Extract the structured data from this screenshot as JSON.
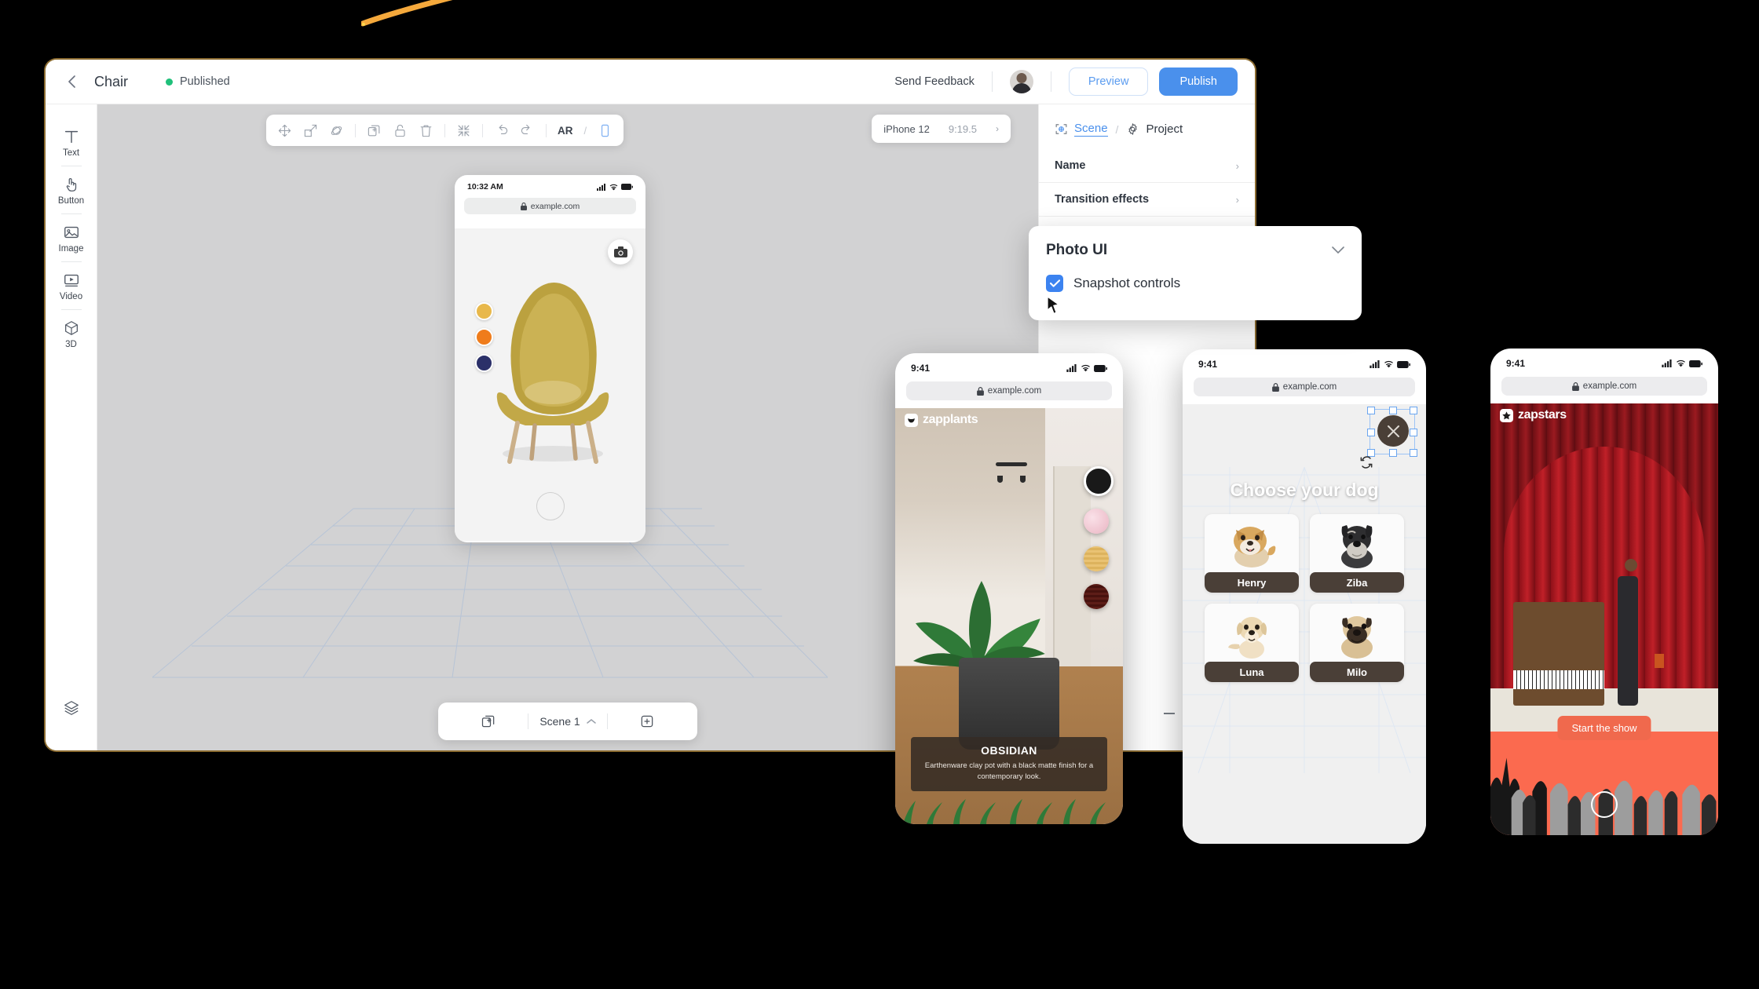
{
  "app": {
    "title": "Chair",
    "status": "Published",
    "status_color": "#1fc07a",
    "back_icon": "chevron-left-icon",
    "header": {
      "feedback": "Send Feedback",
      "preview": "Preview",
      "publish": "Publish",
      "accent": "#4a90ec"
    }
  },
  "sidebar": {
    "items": [
      {
        "label": "Text",
        "icon": "text-icon"
      },
      {
        "label": "Button",
        "icon": "button-tap-icon"
      },
      {
        "label": "Image",
        "icon": "image-icon"
      },
      {
        "label": "Video",
        "icon": "video-icon"
      },
      {
        "label": "3D",
        "icon": "cube-3d-icon"
      }
    ],
    "bottom_icon": "layers-icon"
  },
  "toolbar": {
    "tools": [
      {
        "name": "move-tool",
        "icon": "move-arrows-icon"
      },
      {
        "name": "scale-tool",
        "icon": "scale-icon"
      },
      {
        "name": "rotate-tool",
        "icon": "rotate-3d-icon"
      },
      {
        "name": "duplicate-tool",
        "icon": "duplicate-icon"
      },
      {
        "name": "lock-tool",
        "icon": "unlock-icon"
      },
      {
        "name": "delete-tool",
        "icon": "trash-icon"
      },
      {
        "name": "fit-tool",
        "icon": "collapse-icon"
      },
      {
        "name": "undo-tool",
        "icon": "undo-icon"
      },
      {
        "name": "redo-tool",
        "icon": "redo-icon"
      }
    ],
    "ar_label": "AR",
    "slash": "/",
    "mobile_icon": "mobile-icon"
  },
  "device_selector": {
    "device": "iPhone 12",
    "aspect": "9:19.5",
    "chevron": "›"
  },
  "preview_phone": {
    "time": "10:32 AM",
    "url": "example.com",
    "lock_icon": "lock-icon",
    "snapshot_icon": "camera-icon",
    "swatches": [
      {
        "name": "gold",
        "hex": "#e8b84b"
      },
      {
        "name": "orange",
        "hex": "#ef7c1b"
      },
      {
        "name": "navy",
        "hex": "#2b3069"
      }
    ]
  },
  "scene_bar": {
    "duplicate_icon": "duplicate-scene-icon",
    "scene_label": "Scene 1",
    "chevron": "^",
    "add_icon": "plus-icon"
  },
  "right_panel": {
    "tabs": [
      {
        "label": "Scene",
        "icon": "scene-target-icon",
        "active": true
      },
      {
        "label": "Project",
        "icon": "gear-icon",
        "active": false
      }
    ],
    "separator": "/",
    "rows": [
      {
        "label": "Name",
        "chevron": "›"
      },
      {
        "label": "Transition effects",
        "chevron": "›"
      }
    ]
  },
  "popover": {
    "title": "Photo UI",
    "chevron_icon": "chevron-down-icon",
    "checkbox_checked": true,
    "checkbox_label": "Snapshot controls",
    "checkbox_color": "#3c83f0",
    "cursor_icon": "mouse-cursor-icon"
  },
  "mockups": [
    {
      "id": "zapplants",
      "time": "9:41",
      "url": "example.com",
      "brand": "zapplants",
      "brand_icon": "leaf-badge-icon",
      "material_swatches": [
        {
          "name": "black-matte",
          "hex": "#191919",
          "selected": true
        },
        {
          "name": "pink-marble",
          "hex": "#f0c3cd",
          "selected": false
        },
        {
          "name": "light-wood",
          "hex": "#e3b860",
          "selected": false
        },
        {
          "name": "dark-mahogany",
          "hex": "#5d1d17",
          "selected": false
        }
      ],
      "info_title": "OBSIDIAN",
      "info_desc": "Earthenware clay pot with a black matte finish for a contemporary look."
    },
    {
      "id": "dogs",
      "time": "9:41",
      "url": "example.com",
      "title": "Choose your dog",
      "close_icon": "close-icon",
      "rotate_icon": "rotate-icon",
      "cards": [
        {
          "name": "Henry",
          "breed": "shiba-inu"
        },
        {
          "name": "Ziba",
          "breed": "schnauzer"
        },
        {
          "name": "Luna",
          "breed": "labrador-puppy"
        },
        {
          "name": "Milo",
          "breed": "pug"
        }
      ]
    },
    {
      "id": "zapstars",
      "time": "9:41",
      "url": "example.com",
      "brand": "zapstars",
      "brand_icon": "star-badge-icon",
      "cta": "Start the show",
      "cta_color": "#f0694d",
      "shutter_icon": "shutter-icon"
    }
  ]
}
